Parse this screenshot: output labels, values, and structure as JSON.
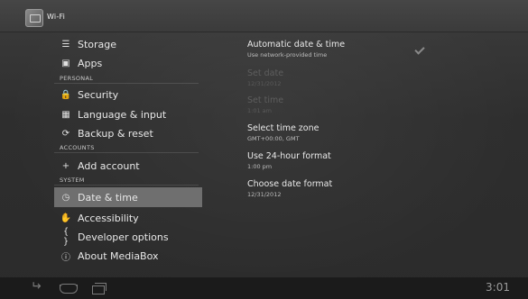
{
  "action_bar": {
    "title": "Wi-Fi",
    "app_icon": "settings-app-icon"
  },
  "menu": {
    "items": [
      {
        "label": "Storage",
        "icon": "storage-icon"
      },
      {
        "label": "Apps",
        "icon": "apps-icon"
      },
      {
        "label": "Security",
        "icon": "lock-icon"
      },
      {
        "label": "Language & input",
        "icon": "language-icon"
      },
      {
        "label": "Backup & reset",
        "icon": "backup-icon"
      },
      {
        "label": "Add account",
        "icon": "plus-icon"
      },
      {
        "label": "Date & time",
        "icon": "clock-icon",
        "selected": true
      },
      {
        "label": "Accessibility",
        "icon": "hand-icon"
      },
      {
        "label": "Developer options",
        "icon": "braces-icon"
      },
      {
        "label": "About MediaBox",
        "icon": "info-icon"
      }
    ],
    "headers": {
      "personal": "PERSONAL",
      "accounts": "ACCOUNTS",
      "system": "SYSTEM"
    }
  },
  "detail": {
    "prefs": [
      {
        "title": "Automatic date & time",
        "summary": "Use network-provided time",
        "enabled": true,
        "checked": true
      },
      {
        "title": "Set date",
        "summary": "12/31/2012",
        "enabled": false
      },
      {
        "title": "Set time",
        "summary": "1:01 am",
        "enabled": false
      },
      {
        "title": "Select time zone",
        "summary": "GMT+00:00, GMT",
        "enabled": true
      },
      {
        "title": "Use 24-hour format",
        "summary": "1:00 pm",
        "enabled": true
      },
      {
        "title": "Choose date format",
        "summary": "12/31/2012",
        "enabled": true
      }
    ]
  },
  "nav_bar": {
    "clock": "3:01",
    "buttons": [
      "back-icon",
      "home-icon",
      "recent-apps-icon"
    ]
  },
  "colors": {
    "selected_bg": "#6f6f6f",
    "background": "#2e2e2e",
    "nav_bg": "#1b1b1b"
  }
}
